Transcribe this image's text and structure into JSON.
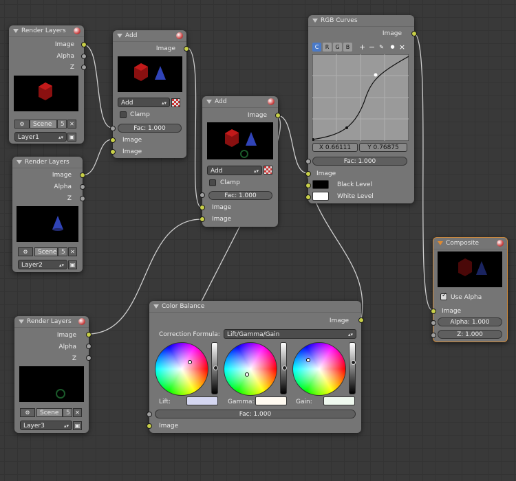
{
  "render_layers_1": {
    "title": "Render Layers",
    "out_image": "Image",
    "out_alpha": "Alpha",
    "out_z": "Z",
    "scene": "Scene",
    "scene_users": "5",
    "layer": "Layer1"
  },
  "render_layers_2": {
    "title": "Render Layers",
    "out_image": "Image",
    "out_alpha": "Alpha",
    "out_z": "Z",
    "scene": "Scene",
    "scene_users": "5",
    "layer": "Layer2"
  },
  "render_layers_3": {
    "title": "Render Layers",
    "out_image": "Image",
    "out_alpha": "Alpha",
    "out_z": "Z",
    "scene": "Scene",
    "scene_users": "5",
    "layer": "Layer3"
  },
  "add_1": {
    "title": "Add",
    "out_image": "Image",
    "blend": "Add",
    "clamp": "Clamp",
    "fac": "Fac: 1.000",
    "in_image_1": "Image",
    "in_image_2": "Image"
  },
  "add_2": {
    "title": "Add",
    "out_image": "Image",
    "blend": "Add",
    "clamp": "Clamp",
    "fac": "Fac: 1.000",
    "in_image_1": "Image",
    "in_image_2": "Image"
  },
  "rgb_curves": {
    "title": "RGB Curves",
    "out_image": "Image",
    "channels": [
      "C",
      "R",
      "G",
      "B"
    ],
    "tools": [
      "+",
      "−",
      "✎",
      "●",
      "×"
    ],
    "x_field": "X 0.66111",
    "y_field": "Y 0.76875",
    "fac": "Fac: 1.000",
    "in_image": "Image",
    "black_level": "Black Level",
    "white_level": "White Level"
  },
  "composite": {
    "title": "Composite",
    "use_alpha": "Use Alpha",
    "in_image": "Image",
    "alpha": "Alpha: 1.000",
    "z": "Z: 1.000"
  },
  "color_balance": {
    "title": "Color Balance",
    "out_image": "Image",
    "formula_label": "Correction Formula:",
    "formula_value": "Lift/Gamma/Gain",
    "lift": "Lift:",
    "gamma": "Gamma:",
    "gain": "Gain:",
    "fac": "Fac: 1.000",
    "in_image": "Image"
  },
  "colors": {
    "socket_color": "#c8cf48",
    "node_body": "#757575",
    "editor_bg": "#393939",
    "curve_active": "#4a7ac8",
    "lift_swatch": "#d4d6f0",
    "gamma_swatch": "#fffaf0",
    "gain_swatch": "#eef8ee"
  }
}
